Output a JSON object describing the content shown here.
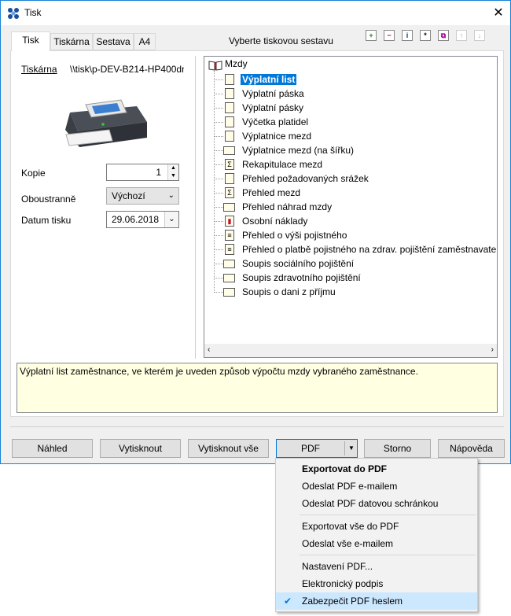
{
  "window": {
    "title": "Tisk",
    "close_glyph": "✕"
  },
  "tabs": [
    {
      "label": "Tisk"
    },
    {
      "label": "Tiskárna"
    },
    {
      "label": "Sestava"
    },
    {
      "label": "A4"
    }
  ],
  "left": {
    "printer_label": "Tiskárna",
    "printer_path": "\\\\tisk\\p-DEV-B214-HP400dn",
    "copies_label": "Kopie",
    "copies_value": "1",
    "duplex_label": "Oboustranně",
    "duplex_value": "Výchozí",
    "date_label": "Datum tisku",
    "date_value": "29.06.2018"
  },
  "report_select_label": "Vyberte tiskovou sestavu",
  "toolbar_icons": [
    "add-icon",
    "remove-icon",
    "info-icon",
    "new-icon",
    "copy-icon",
    "move-up-icon",
    "move-down-icon"
  ],
  "tree": {
    "root": "Mzdy",
    "items": [
      {
        "label": "Výplatní list",
        "selected": true,
        "icon": "page-icon"
      },
      {
        "label": "Výplatní páska",
        "icon": "page-icon"
      },
      {
        "label": "Výplatní pásky",
        "icon": "page-icon"
      },
      {
        "label": "Výčetka platidel",
        "icon": "page-icon"
      },
      {
        "label": "Výplatnice mezd",
        "icon": "page-icon"
      },
      {
        "label": "Výplatnice mezd (na šířku)",
        "icon": "landscape-page-icon"
      },
      {
        "label": "Rekapitulace mezd",
        "icon": "sum-icon"
      },
      {
        "label": "Přehled požadovaných srážek",
        "icon": "page-icon"
      },
      {
        "label": "Přehled mezd",
        "icon": "sum-icon"
      },
      {
        "label": "Přehled náhrad mzdy",
        "icon": "landscape-page-icon"
      },
      {
        "label": "Osobní náklady",
        "icon": "chart-page-icon"
      },
      {
        "label": "Přehled o výši pojistného",
        "icon": "form-page-icon"
      },
      {
        "label": "Přehled o platbě pojistného na zdrav. pojištění zaměstnavatele",
        "icon": "form-page-icon"
      },
      {
        "label": "Soupis sociálního pojištění",
        "icon": "landscape-page-icon"
      },
      {
        "label": "Soupis zdravotního pojištění",
        "icon": "landscape-page-icon"
      },
      {
        "label": "Soupis o dani z příjmu",
        "icon": "landscape-page-icon"
      }
    ]
  },
  "description": "Výplatní list zaměstnance, ve kterém je uveden způsob výpočtu mzdy vybraného zaměstnance.",
  "buttons": {
    "preview": "Náhled",
    "print": "Vytisknout",
    "print_all": "Vytisknout vše",
    "pdf": "PDF",
    "cancel": "Storno",
    "help": "Nápověda"
  },
  "pdf_menu": [
    {
      "label": "Exportovat do PDF",
      "bold": true
    },
    {
      "label": "Odeslat PDF e-mailem"
    },
    {
      "label": "Odeslat PDF datovou schránkou"
    },
    {
      "label": "Exportovat vše do PDF"
    },
    {
      "label": "Odeslat vše e-mailem"
    },
    {
      "label": "Nastavení PDF..."
    },
    {
      "label": "Elektronický podpis"
    },
    {
      "label": "Zabezpečit PDF heslem",
      "checked": true
    }
  ],
  "colors": {
    "accent": "#0078d7",
    "description_bg": "#ffffe1"
  }
}
